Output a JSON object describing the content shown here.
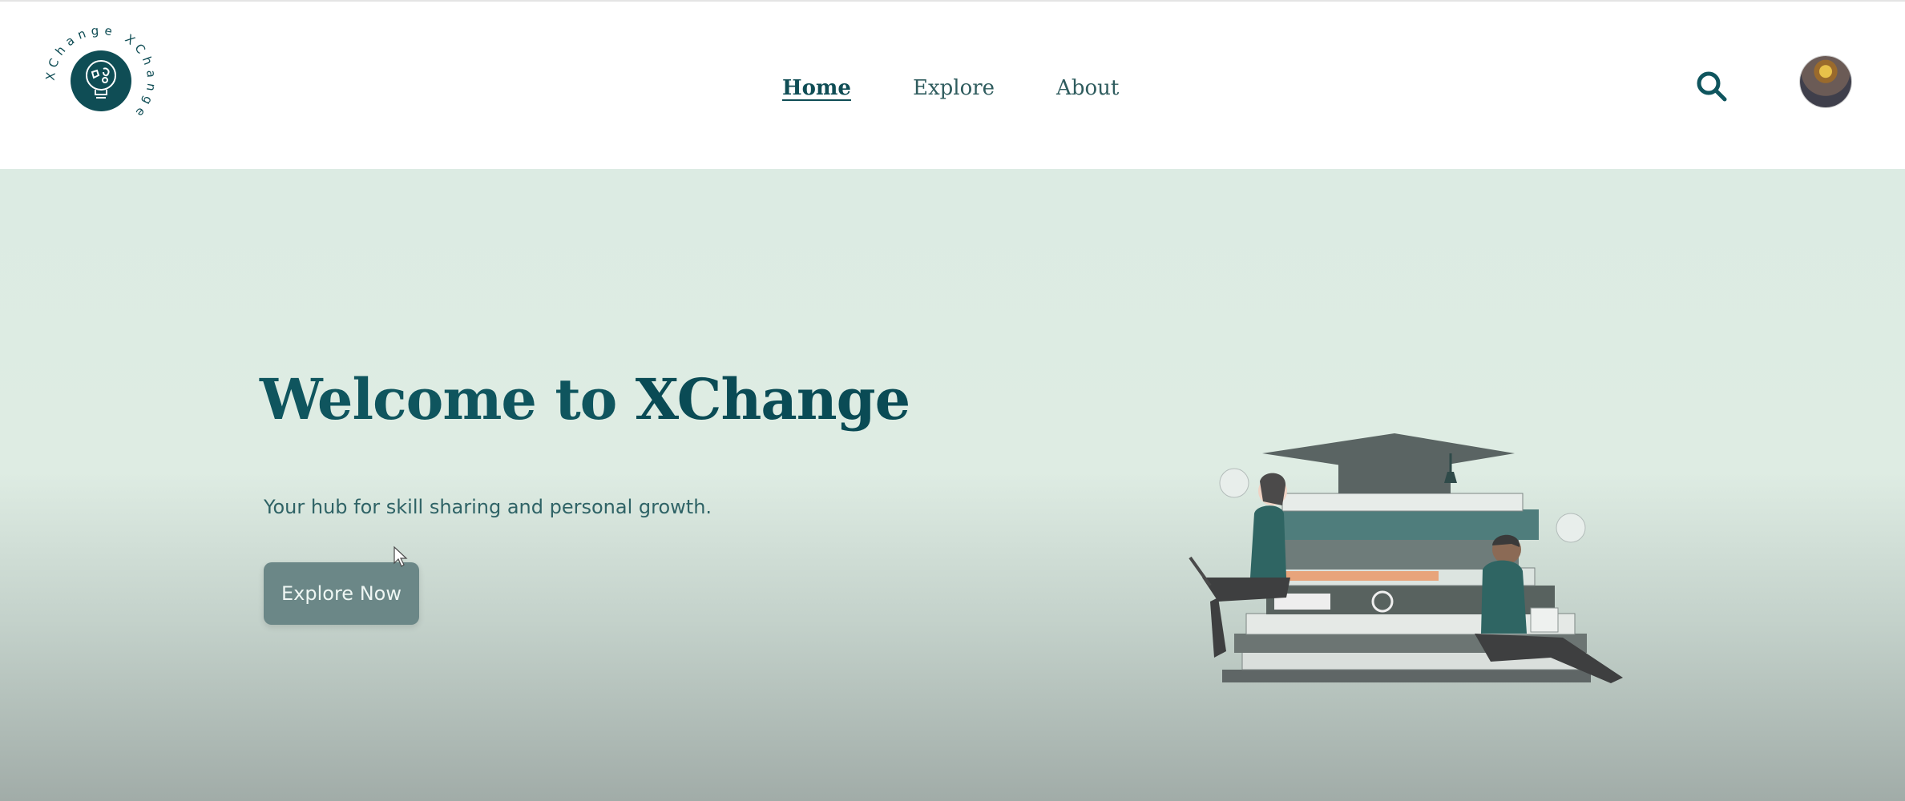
{
  "brand": {
    "logo_ring_text": "XChange XChange",
    "logo_icon": "lightbulb-globe-icon"
  },
  "nav": {
    "items": [
      {
        "label": "Home",
        "active": true
      },
      {
        "label": "Explore",
        "active": false
      },
      {
        "label": "About",
        "active": false
      }
    ]
  },
  "header_actions": {
    "search_icon": "search-icon",
    "avatar": "user-avatar"
  },
  "hero": {
    "title_prefix": "Welcome to ",
    "title_brand": "XChange",
    "subtitle": "Your hub for skill sharing and personal growth.",
    "cta_label": "Explore Now",
    "illustration": "graduation-cap-on-book-stack-with-students-illustration"
  },
  "colors": {
    "primary": "#0f555e",
    "nav_text": "#2f5c5e",
    "hero_bg_top": "#dcebe3",
    "hero_bg_bottom": "#a1aca8",
    "cta_bg": "#6b8787"
  }
}
